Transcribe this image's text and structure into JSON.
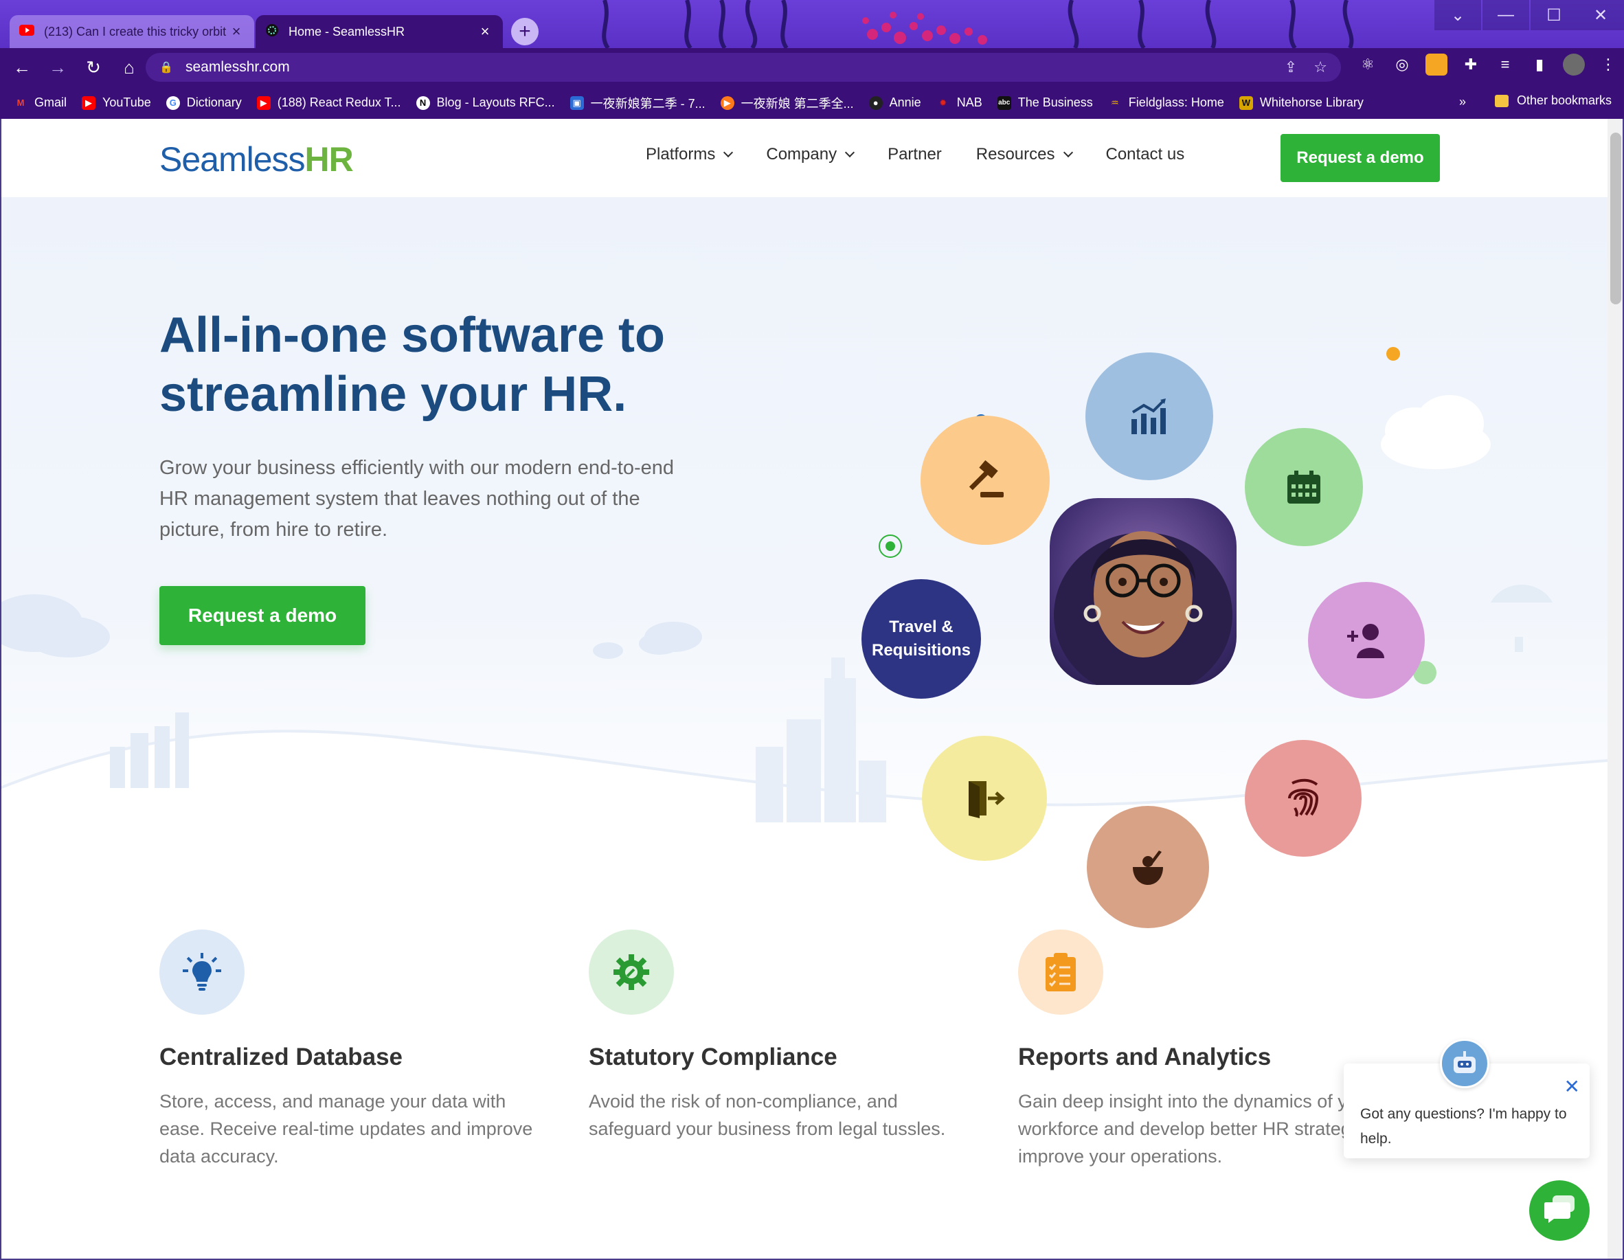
{
  "browser": {
    "tabs": [
      {
        "title": "(213) Can I create this tricky orbit",
        "favicon": "youtube-icon",
        "active": false
      },
      {
        "title": "Home - SeamlessHR",
        "favicon": "seamlesshr-icon",
        "active": true
      }
    ],
    "new_tab": "+",
    "window_controls": [
      "⌄",
      "—",
      "☐",
      "✕"
    ],
    "address": "seamlesshr.com",
    "bookmarks": [
      {
        "label": "Gmail",
        "icon": "gmail-icon",
        "color": "#ea4335"
      },
      {
        "label": "YouTube",
        "icon": "youtube-icon",
        "color": "#ff0000"
      },
      {
        "label": "Dictionary",
        "icon": "google-icon",
        "color": "#ffffff"
      },
      {
        "label": "(188) React Redux T...",
        "icon": "youtube-icon",
        "color": "#ff0000"
      },
      {
        "label": "Blog - Layouts RFC...",
        "icon": "notion-icon",
        "color": "#ffffff"
      },
      {
        "label": "一夜新娘第二季 - 7...",
        "icon": "video-icon",
        "color": "#2a6bd6"
      },
      {
        "label": "一夜新娘 第二季全...",
        "icon": "play-icon",
        "color": "#ff7a1a"
      },
      {
        "label": "Annie",
        "icon": "github-icon",
        "color": "#222222"
      },
      {
        "label": "NAB",
        "icon": "nab-icon",
        "color": "#e0261b"
      },
      {
        "label": "The Business",
        "icon": "abc-icon",
        "color": "#111111"
      },
      {
        "label": "Fieldglass: Home",
        "icon": "fieldglass-icon",
        "color": "#f0b400"
      },
      {
        "label": "Whitehorse Library",
        "icon": "library-icon",
        "color": "#d8a400"
      }
    ],
    "bookmarks_more": "»",
    "other_bookmarks": "Other bookmarks"
  },
  "site": {
    "logo_text": "Seamless",
    "logo_accent": "HR",
    "nav": [
      {
        "label": "Platforms",
        "dropdown": true
      },
      {
        "label": "Company",
        "dropdown": true
      },
      {
        "label": "Partner",
        "dropdown": false
      },
      {
        "label": "Resources",
        "dropdown": true
      },
      {
        "label": "Contact us",
        "dropdown": false
      }
    ],
    "header_cta": "Request a demo"
  },
  "hero": {
    "title": "All-in-one software to streamline your HR.",
    "subtitle": "Grow your business efficiently with our modern end-to-end HR management system that leaves nothing out of the picture, from hire to retire.",
    "cta": "Request a demo",
    "travel_bubble": "Travel & Requisitions"
  },
  "features": [
    {
      "title": "Centralized Database",
      "text": "Store, access, and manage your data with ease. Receive real-time updates and improve data accuracy.",
      "icon": "lightbulb-icon"
    },
    {
      "title": "Statutory Compliance",
      "text": "Avoid the risk of non-compliance, and safeguard your business from legal tussles.",
      "icon": "gear-wrench-icon"
    },
    {
      "title": "Reports and Analytics",
      "text": "Gain deep insight into the dynamics of your workforce and develop better HR strategies to improve your operations.",
      "icon": "clipboard-check-icon"
    }
  ],
  "chat": {
    "message": "Got any questions? I'm happy to help.",
    "close": "✕"
  },
  "colors": {
    "brand_blue": "#1f5ea8",
    "brand_green": "#2eb238",
    "heading_navy": "#1b4b7f",
    "browser_purple": "#3a0f78"
  }
}
